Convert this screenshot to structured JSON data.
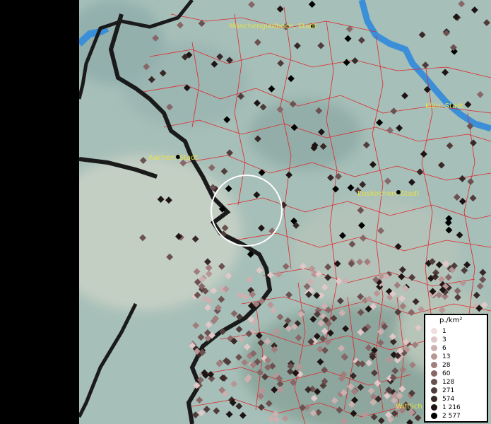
{
  "map": {
    "cities": [
      {
        "name": "Mönchengladbach, Stadt"
      },
      {
        "name": "Köln, Stadt"
      },
      {
        "name": "Aachen, Stadt"
      },
      {
        "name": "Euskirchen, Stadt"
      },
      {
        "name": "Wittlich"
      }
    ],
    "colors": {
      "background": "#9fb8b3",
      "lowland": "#b4c5bd",
      "boundaries": "#e0252a",
      "river": "#3a8fd8",
      "border": "#1a1a1a",
      "highlight": "#ffffff"
    }
  },
  "legend": {
    "title": "p./km²",
    "entries": [
      {
        "label": "1",
        "color": "#f1dede"
      },
      {
        "label": "3",
        "color": "#e0c8c8"
      },
      {
        "label": "6",
        "color": "#cdb0b0"
      },
      {
        "label": "13",
        "color": "#b89696"
      },
      {
        "label": "28",
        "color": "#a17e7e"
      },
      {
        "label": "60",
        "color": "#876767"
      },
      {
        "label": "128",
        "color": "#6c5151"
      },
      {
        "label": "271",
        "color": "#513c3c"
      },
      {
        "label": "574",
        "color": "#382828"
      },
      {
        "label": "1 216",
        "color": "#1f1414"
      },
      {
        "label": "2 577",
        "color": "#000000"
      }
    ]
  }
}
